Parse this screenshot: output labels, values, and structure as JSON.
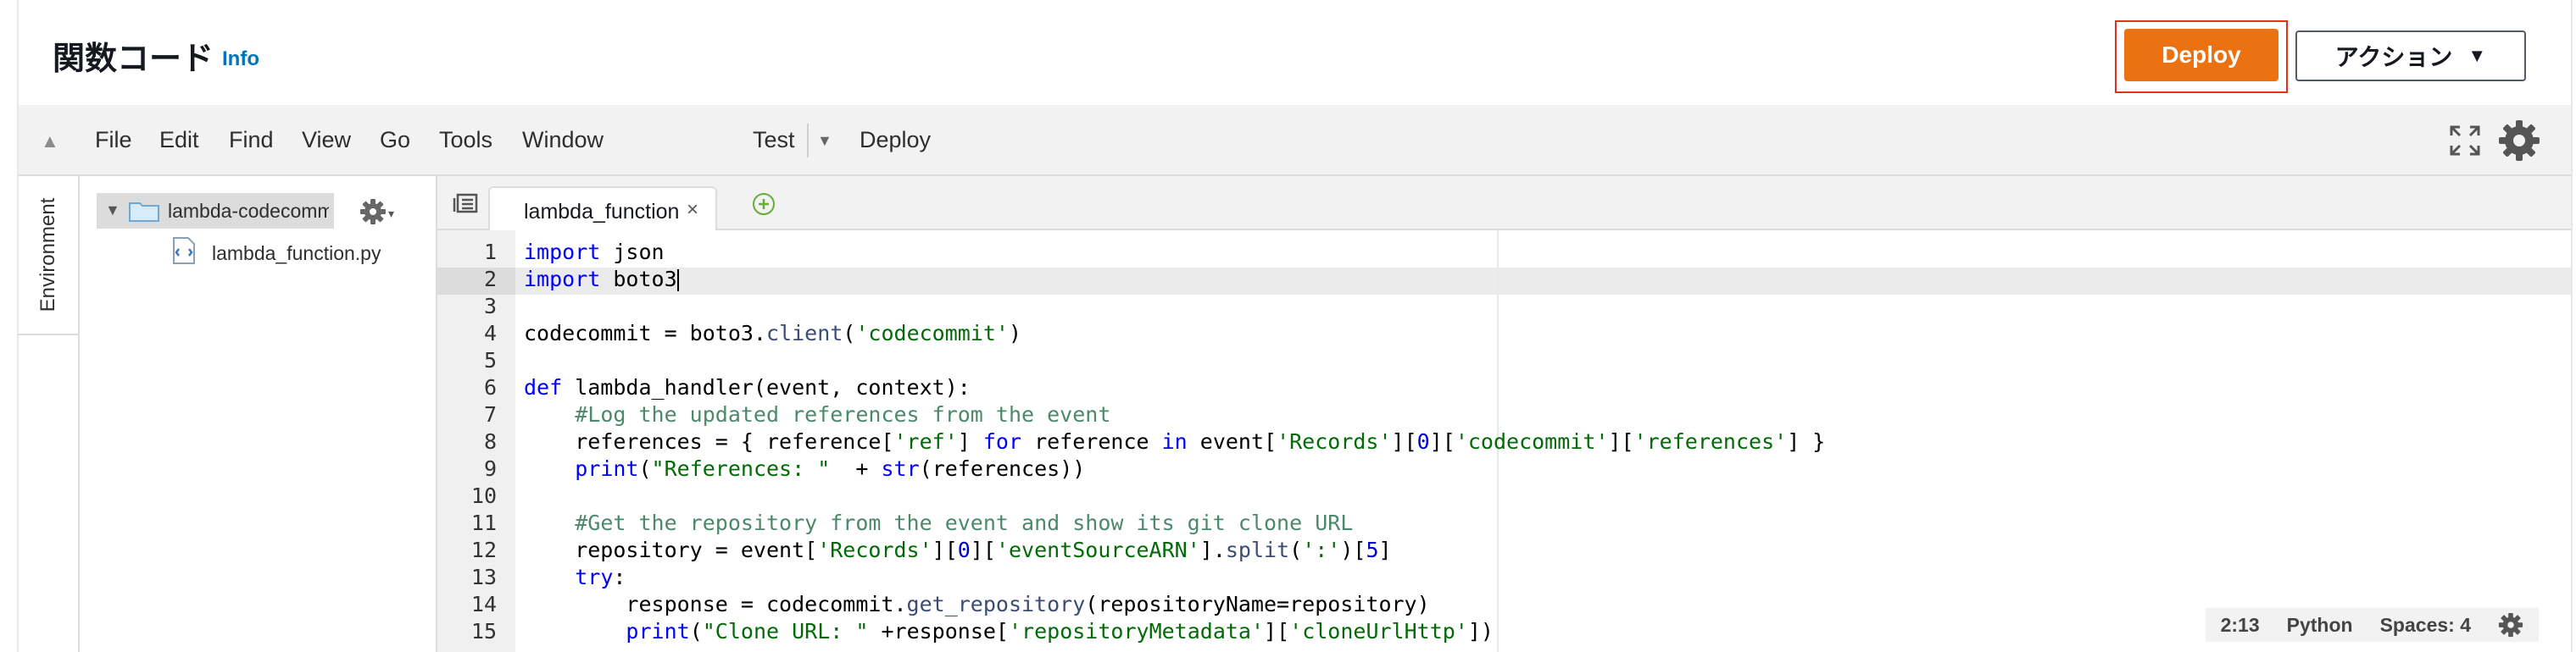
{
  "header": {
    "title": "関数コード",
    "info": "Info",
    "deploy_label": "Deploy",
    "action_label": "アクション",
    "action_caret": "▼"
  },
  "menubar": {
    "collapse": "▲",
    "items": [
      "File",
      "Edit",
      "Find",
      "View",
      "Go",
      "Tools",
      "Window"
    ],
    "test_label": "Test",
    "test_caret": "▼",
    "deploy_label": "Deploy"
  },
  "env_tab": "Environment",
  "tree": {
    "root_toggle": "▼",
    "root_label": "lambda-codecommit",
    "gear_caret": "▾",
    "file_label": "lambda_function.py"
  },
  "editor": {
    "tab_label": "lambda_function",
    "tab_close": "×",
    "line_numbers": [
      "1",
      "2",
      "3",
      "4",
      "5",
      "6",
      "7",
      "8",
      "9",
      "10",
      "11",
      "12",
      "13",
      "14",
      "15"
    ]
  },
  "status": {
    "position": "2:13",
    "language": "Python",
    "spaces": "Spaces: 4"
  },
  "colors": {
    "deploy": "#ec7211",
    "highlight": "#e0301e",
    "info_link": "#0073bb"
  }
}
